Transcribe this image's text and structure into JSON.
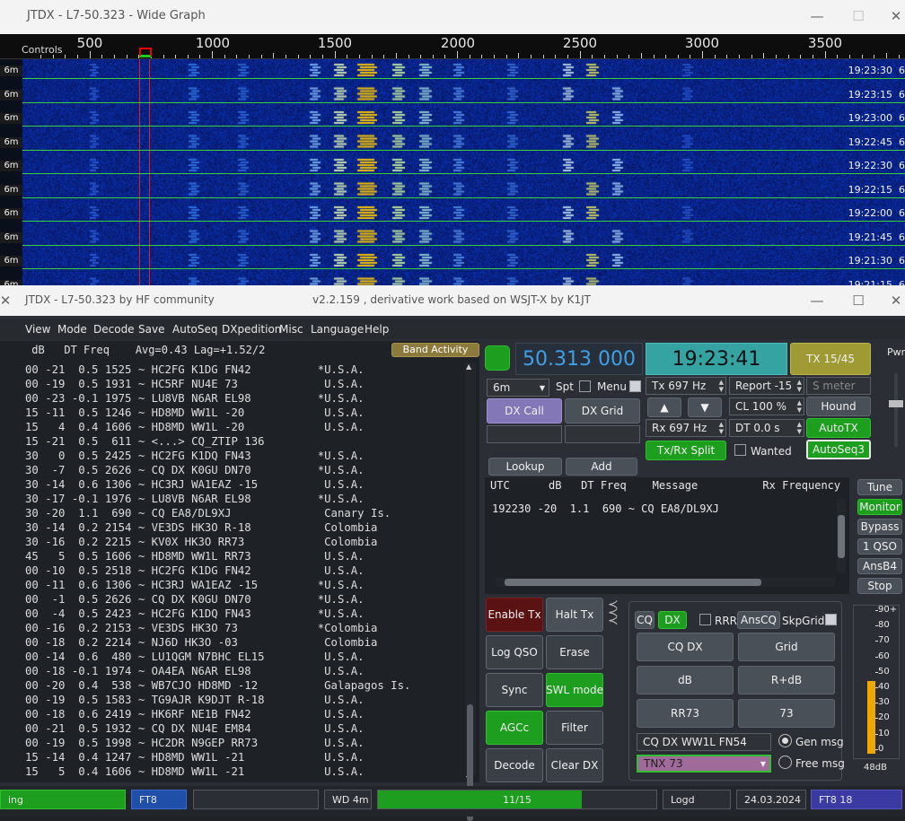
{
  "wide_graph": {
    "title": "JTDX - L7-50.323 - Wide Graph",
    "controls_label": "Controls",
    "scale_labels": [
      "500",
      "1000",
      "1500",
      "2000",
      "2500",
      "3000",
      "3500"
    ],
    "rows": [
      {
        "band": "6m",
        "time": "19:23:30"
      },
      {
        "band": "6m",
        "time": "19:23:15"
      },
      {
        "band": "6m",
        "time": "19:23:00"
      },
      {
        "band": "6m",
        "time": "19:22:45"
      },
      {
        "band": "6m",
        "time": "19:22:30"
      },
      {
        "band": "6m",
        "time": "19:22:15"
      },
      {
        "band": "6m",
        "time": "19:22:00"
      },
      {
        "band": "6m",
        "time": "19:21:45"
      },
      {
        "band": "6m",
        "time": "19:21:30"
      },
      {
        "band": "6m",
        "time": "19:21:15"
      }
    ],
    "edge_digit": "6"
  },
  "main": {
    "title": "JTDX - L7-50.323  by HF community",
    "subtitle": "v2.2.159 , derivative work based on WSJT-X by K1JT",
    "menu": [
      "View",
      "Mode",
      "Decode",
      "Save",
      "AutoSeq",
      "DXpedition",
      "Misc",
      "Language",
      "Help"
    ],
    "decode_header": " dB   DT Freq    Avg=0.43 Lag=+1.52/2",
    "band_activity_label": "Band Activity",
    "decodes": [
      "00 -21  0.5 1525 ~ HC2FG K1DG FN42          *U.S.A.",
      "00 -19  0.5 1931 ~ HC5RF NU4E 73             U.S.A.",
      "00 -23 -0.1 1975 ~ LU8VB N6AR EL98          *U.S.A.",
      "15 -11  0.5 1246 ~ HD8MD WW1L -20            U.S.A.",
      "15   4  0.4 1606 ~ HD8MD WW1L -20            U.S.A.",
      "15 -21  0.5  611 ~ <...> CQ_ZTIP 136",
      "30   0  0.5 2425 ~ HC2FG K1DQ FN43          *U.S.A.",
      "30  -7  0.5 2626 ~ CQ DX K0GU DN70          *U.S.A.",
      "30 -14  0.6 1306 ~ HC3RJ WA1EAZ -15          U.S.A.",
      "30 -17 -0.1 1976 ~ LU8VB N6AR EL98          *U.S.A.",
      "30 -20  1.1  690 ~ CQ EA8/DL9XJ              Canary Is.",
      "30 -14  0.2 2154 ~ VE3DS HK3O R-18           Colombia",
      "30 -16  0.2 2215 ~ KV0X HK3O RR73            Colombia",
      "45   5  0.5 1606 ~ HD8MD WW1L RR73           U.S.A.",
      "00 -10  0.5 2518 ~ HC2FG K1DG FN42           U.S.A.",
      "00 -11  0.6 1306 ~ HC3RJ WA1EAZ -15         *U.S.A.",
      "00  -1  0.5 2626 ~ CQ DX K0GU DN70          *U.S.A.",
      "00  -4  0.5 2423 ~ HC2FG K1DQ FN43          *U.S.A.",
      "00 -16  0.2 2153 ~ VE3DS HK3O 73            *Colombia",
      "00 -18  0.2 2214 ~ NJ6D HK3O -03             Colombia",
      "00 -14  0.6  480 ~ LU1QGM N7BHC EL15         U.S.A.",
      "00 -18 -0.1 1974 ~ OA4EA N6AR EL98           U.S.A.",
      "00 -20  0.4  538 ~ WB7CJO HD8MD -12          Galapagos Is.",
      "00 -19  0.5 1583 ~ TG9AJR K9DJT R-18         U.S.A.",
      "00 -18  0.6 2419 ~ HK6RF NE1B FN42           U.S.A.",
      "00 -21  0.5 1932 ~ CQ DX NU4E EM84           U.S.A.",
      "00 -19  0.5 1998 ~ HC2DR N9GEP RR73          U.S.A.",
      "15 -14  0.4 1247 ~ HD8MD WW1L -21            U.S.A.",
      "15   5  0.4 1606 ~ HD8MD WW1L -21            U.S.A."
    ],
    "left_col": {
      "pwr": "wr",
      "buttons": [
        "e",
        "or",
        "ss",
        "O",
        "4",
        "o"
      ],
      "plus": "+"
    },
    "dial_freq": "50.313 000",
    "clock": "19:23:41",
    "tx_period": "TX 15/45",
    "band": "6m",
    "spt_label": "Spt",
    "menu_label": "Menu",
    "tx_hz": "Tx  697 Hz",
    "report": "Report -15",
    "s_meter_placeholder": "S meter",
    "dx_call_btn": "DX Call",
    "dx_grid_btn": "DX Grid",
    "up_arrow": "▲",
    "down_arrow": "▼",
    "cl": "CL  100 %",
    "hound": "Hound",
    "rx_hz": "Rx  697 Hz",
    "dt": "DT 0.0 s",
    "autotx": "AutoTX",
    "txrx_split": "Tx/Rx Split",
    "wanted": "Wanted",
    "autoseq3": "AutoSeq3",
    "lookup": "Lookup",
    "add": "Add",
    "rx_header": "UTC      dB   DT Freq    Message          Rx Frequency",
    "rx_line": "192230 -20  1.1  690 ~ CQ EA8/DL9XJ",
    "right_col": [
      "Tune",
      "Monitor",
      "Bypass",
      "1 QSO",
      "AnsB4",
      "Stop"
    ],
    "pwr_label": "Pwr",
    "tx_buttons": {
      "enable_tx": "Enable Tx",
      "halt_tx": "Halt Tx",
      "log_qso": "Log QSO",
      "erase": "Erase",
      "sync": "Sync",
      "swl_mode": "SWL mode",
      "agcc": "AGCc",
      "filter": "Filter",
      "decode": "Decode",
      "clear_dx": "Clear DX"
    },
    "msg_panel": {
      "cq": "CQ",
      "dx": "DX",
      "rrr": "RRR",
      "anscq": "AnsCQ",
      "skpgrid": "SkpGrid",
      "cq_dx": "CQ DX",
      "grid": "Grid",
      "db": "dB",
      "r_db": "R+dB",
      "rr73": "RR73",
      "s73": "73",
      "gen_field": "CQ DX WW1L FN54",
      "gen_msg": "Gen msg",
      "free_field": "TNX 73",
      "free_msg": "Free msg"
    },
    "meter": {
      "labels": [
        "90+",
        "80",
        "70",
        "60",
        "50",
        "40",
        "30",
        "20",
        "10",
        "0"
      ],
      "level_db": 48,
      "readout": "48dB"
    },
    "status": {
      "s1": "ing",
      "mode": "FT8",
      "empty": "",
      "wd": "WD 4m",
      "progress_text": "11/15",
      "progress_fraction": 0.733,
      "logd": "Logd",
      "date": "24.03.2024",
      "mode2": "FT8  18"
    }
  }
}
